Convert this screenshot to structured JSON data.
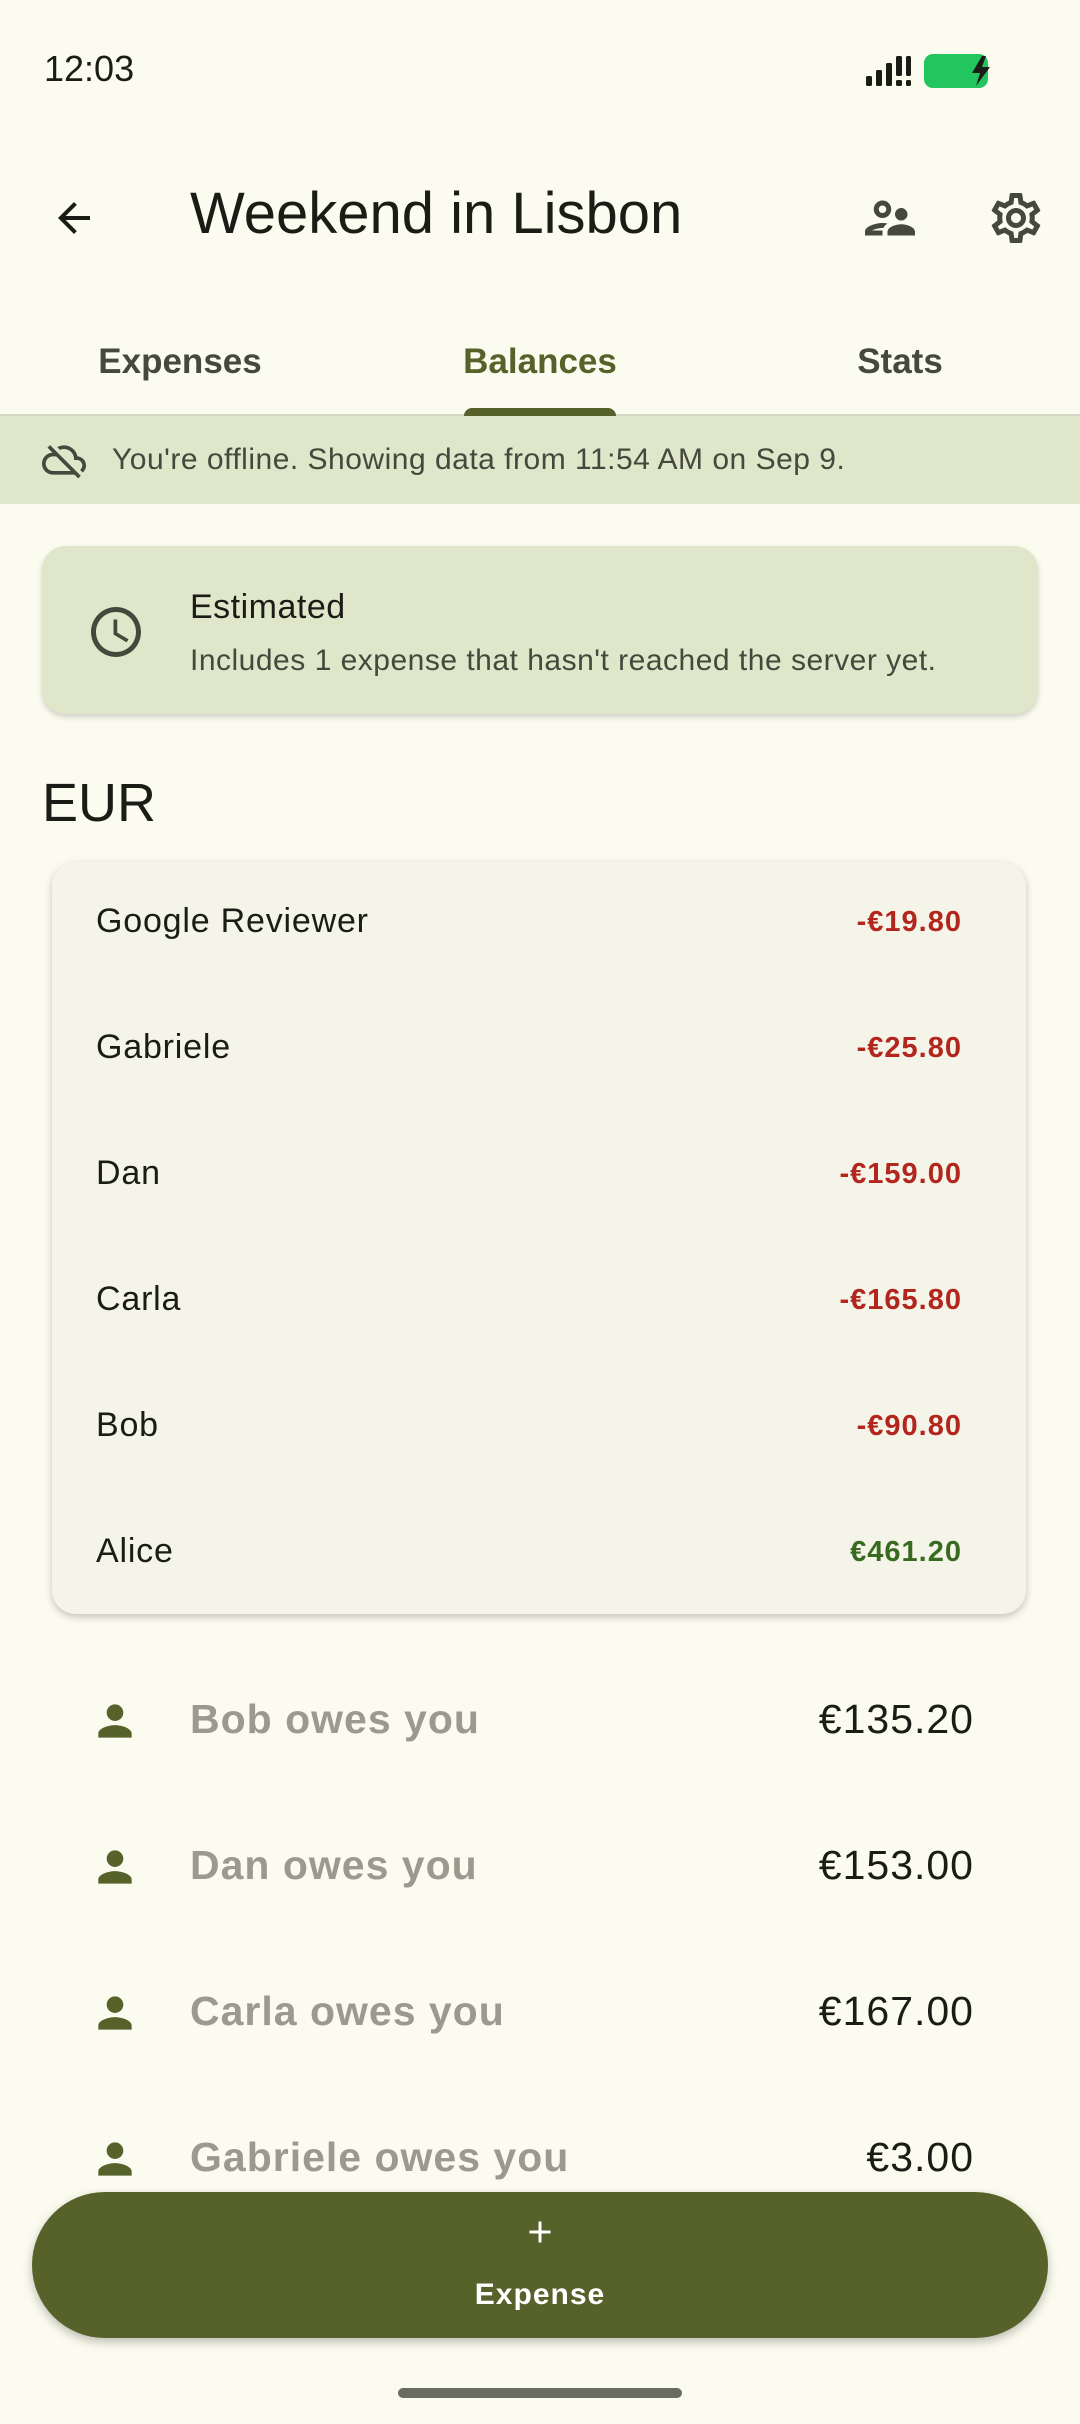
{
  "status_bar": {
    "time": "12:03"
  },
  "app_bar": {
    "title": "Weekend in Lisbon"
  },
  "tabs": [
    {
      "label": "Expenses"
    },
    {
      "label": "Balances"
    },
    {
      "label": "Stats"
    }
  ],
  "active_tab": "Balances",
  "offline_banner": {
    "text": "You're offline. Showing data from 11:54 AM on Sep 9."
  },
  "estimated_card": {
    "title": "Estimated",
    "subtitle": "Includes 1 expense that hasn't reached the server yet."
  },
  "currency": "EUR",
  "balances": [
    {
      "name": "Google Reviewer",
      "amount": "-€19.80",
      "sign": "negative"
    },
    {
      "name": "Gabriele",
      "amount": "-€25.80",
      "sign": "negative"
    },
    {
      "name": "Dan",
      "amount": "-€159.00",
      "sign": "negative"
    },
    {
      "name": "Carla",
      "amount": "-€165.80",
      "sign": "negative"
    },
    {
      "name": "Bob",
      "amount": "-€90.80",
      "sign": "negative"
    },
    {
      "name": "Alice",
      "amount": "€461.20",
      "sign": "positive"
    }
  ],
  "debts": [
    {
      "label": "Bob owes you",
      "amount": "€135.20"
    },
    {
      "label": "Dan owes you",
      "amount": "€153.00"
    },
    {
      "label": "Carla owes you",
      "amount": "€167.00"
    },
    {
      "label": "Gabriele owes you",
      "amount": "€3.00"
    }
  ],
  "fab": {
    "label": "Expense"
  },
  "colors": {
    "background": "#fbfbef",
    "primary": "#56622a",
    "negative": "#b3261e",
    "positive": "#386a20",
    "banner": "#dfe6c9"
  },
  "icons": {
    "back": "arrow-back-icon",
    "members": "people-icon",
    "settings": "gear-icon",
    "offline": "cloud-off-icon",
    "estimated": "clock-icon",
    "person": "person-icon",
    "add": "plus-icon"
  }
}
